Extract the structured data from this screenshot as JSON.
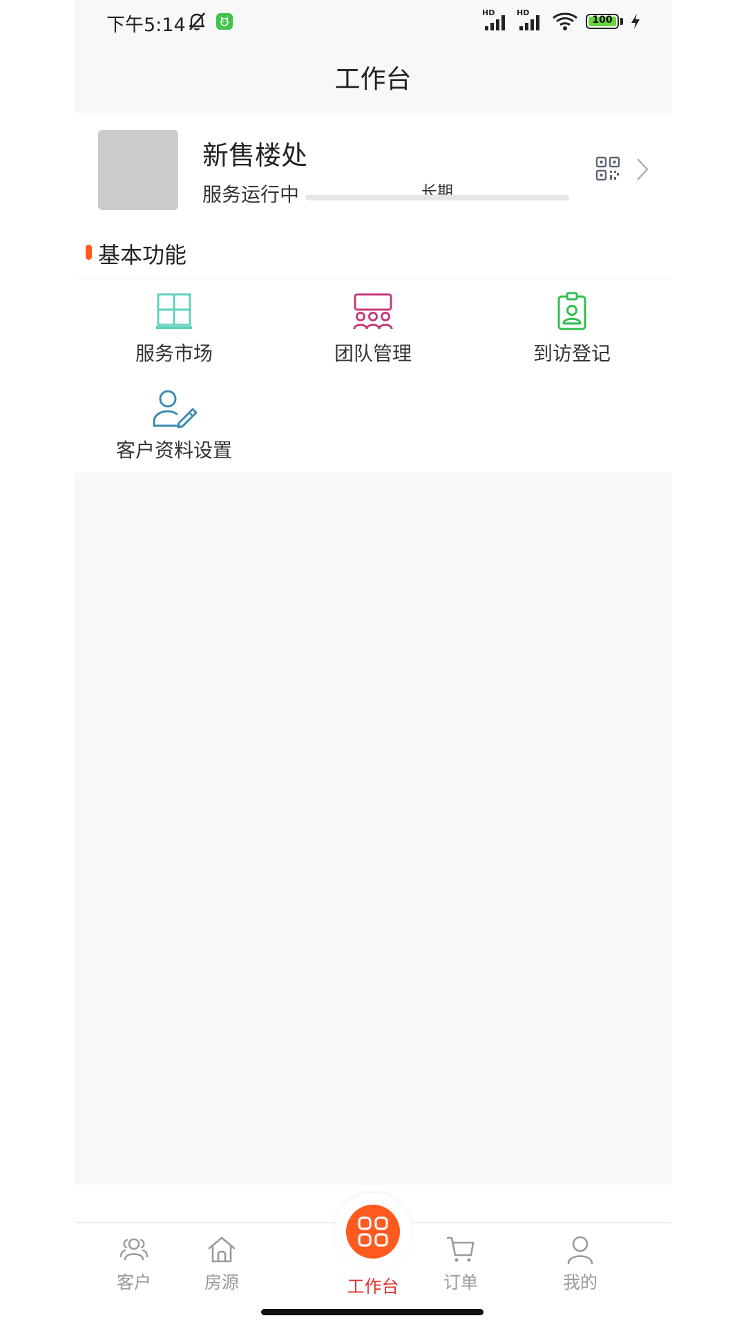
{
  "status_bar": {
    "time": "下午5:14",
    "signal1_label": "HD",
    "signal2_label": "HD",
    "battery_level": "100",
    "battery_percent": 100,
    "icons": [
      "bell-off-icon",
      "app-badge-icon",
      "signal-icon",
      "wifi-icon",
      "battery-icon",
      "charging-icon"
    ]
  },
  "nav": {
    "title": "工作台"
  },
  "project": {
    "name": "新售楼处",
    "status": "服务运行中",
    "period_label": "长期",
    "thumbnail_color": "#cccccc",
    "icons": [
      "qr-code-icon",
      "chevron-right-icon"
    ]
  },
  "section": {
    "title": "基本功能",
    "marker_color": "#ff5a1f"
  },
  "functions": [
    {
      "label": "服务市场",
      "icon": "window-grid-icon",
      "color": "#5fd3bb"
    },
    {
      "label": "团队管理",
      "icon": "team-icon",
      "color": "#c43b7a"
    },
    {
      "label": "到访登记",
      "icon": "visitor-badge-icon",
      "color": "#2fbf4e"
    },
    {
      "label": "客户资料设置",
      "icon": "user-edit-icon",
      "color": "#3a8ab0"
    }
  ],
  "tabbar": {
    "items": [
      {
        "label": "客户",
        "icon": "customers-icon",
        "active": false
      },
      {
        "label": "房源",
        "icon": "house-icon",
        "active": false
      },
      {
        "label": "工作台",
        "icon": "workbench-grid-icon",
        "active": true
      },
      {
        "label": "订单",
        "icon": "cart-icon",
        "active": false
      },
      {
        "label": "我的",
        "icon": "profile-icon",
        "active": false
      }
    ],
    "active_color": "#e5352b",
    "inactive_color": "#9a9a9a",
    "fab_color": "#ff5a1f"
  }
}
